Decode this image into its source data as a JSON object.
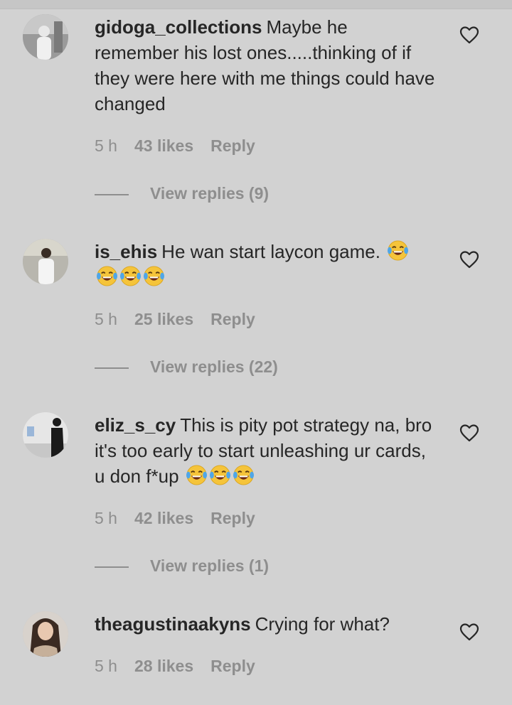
{
  "comments": [
    {
      "username": "gidoga_collections",
      "text": "Maybe he remember his lost ones.....thinking of if they were here with me things could have changed",
      "emojis": [],
      "time": "5 h",
      "likes": "43 likes",
      "reply": "Reply",
      "view_replies": "View replies (9)"
    },
    {
      "username": "is_ehis",
      "text": "He wan start laycon game.",
      "emojis": [
        "face-with-tears-of-joy-icon",
        "face-with-tears-of-joy-icon",
        "face-with-tears-of-joy-icon",
        "face-with-tears-of-joy-icon"
      ],
      "time": "5 h",
      "likes": "25 likes",
      "reply": "Reply",
      "view_replies": "View replies (22)"
    },
    {
      "username": "eliz_s_cy",
      "text": "This is pity pot strategy na, bro it's too early to start unleashing ur cards, u don f*up",
      "emojis": [
        "face-with-tears-of-joy-icon",
        "face-with-tears-of-joy-icon",
        "face-with-tears-of-joy-icon"
      ],
      "time": "5 h",
      "likes": "42 likes",
      "reply": "Reply",
      "view_replies": "View replies (1)"
    },
    {
      "username": "theagustinaakyns",
      "text": "Crying for what?",
      "emojis": [],
      "time": "5 h",
      "likes": "28 likes",
      "reply": "Reply",
      "view_replies": ""
    }
  ],
  "icons": {
    "like": "heart-outline-icon",
    "emoji": "face-with-tears-of-joy-icon"
  },
  "colors": {
    "background": "#d2d2d2",
    "text": "#262626",
    "secondary": "#8e8e8e"
  }
}
